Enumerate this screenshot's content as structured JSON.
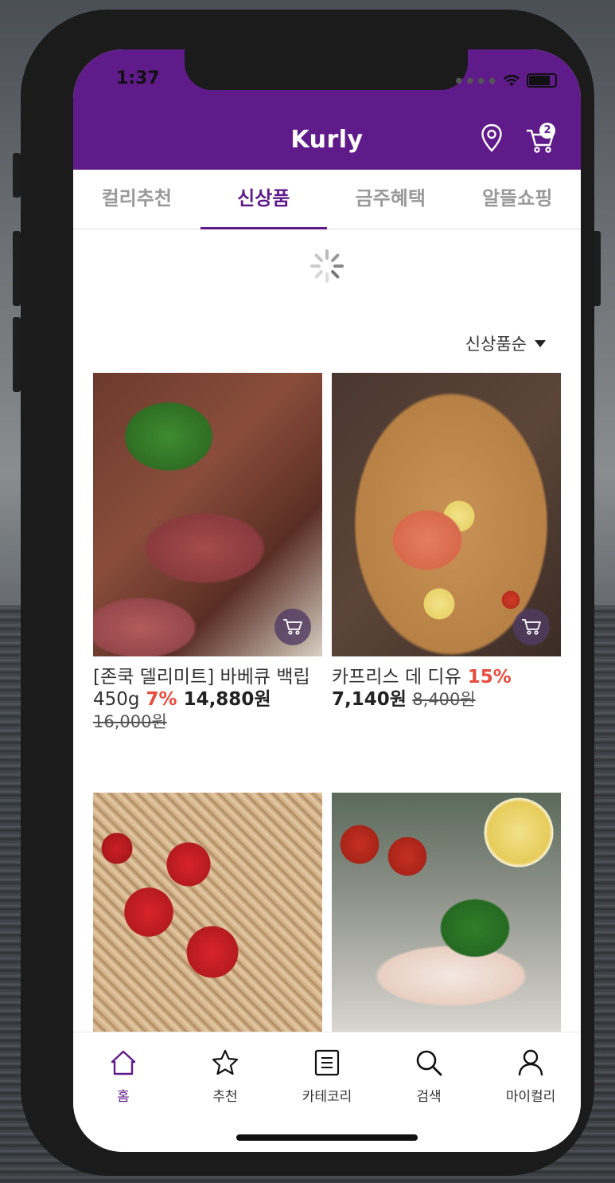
{
  "colors": {
    "brand": "#5f1b8a",
    "discount": "#e84c3d"
  },
  "status_bar": {
    "time": "1:37"
  },
  "header": {
    "title": "Kurly",
    "cart_count": "2",
    "icons": [
      "location-pin-icon",
      "cart-icon"
    ]
  },
  "tabs": [
    {
      "label": "컬리추천",
      "active": false
    },
    {
      "label": "신상품",
      "active": true
    },
    {
      "label": "금주혜택",
      "active": false
    },
    {
      "label": "알뜰쇼핑",
      "active": false
    }
  ],
  "sort": {
    "label": "신상품순"
  },
  "products": [
    {
      "name": "[존쿡 델리미트] 바베큐 백립 450g",
      "discount": "7%",
      "price": "14,880원",
      "original_price": "16,000원"
    },
    {
      "name": "카프리스 데 디유",
      "discount": "15%",
      "price": "7,140원",
      "original_price": "8,400원"
    },
    {
      "name": "",
      "discount": "",
      "price": "",
      "original_price": ""
    },
    {
      "name": "",
      "discount": "",
      "price": "",
      "original_price": ""
    }
  ],
  "bottom_nav": [
    {
      "label": "홈",
      "icon": "home-icon",
      "active": true
    },
    {
      "label": "추천",
      "icon": "star-icon",
      "active": false
    },
    {
      "label": "카테코리",
      "icon": "list-icon",
      "active": false
    },
    {
      "label": "검색",
      "icon": "search-icon",
      "active": false
    },
    {
      "label": "마이컬리",
      "icon": "user-icon",
      "active": false
    }
  ]
}
